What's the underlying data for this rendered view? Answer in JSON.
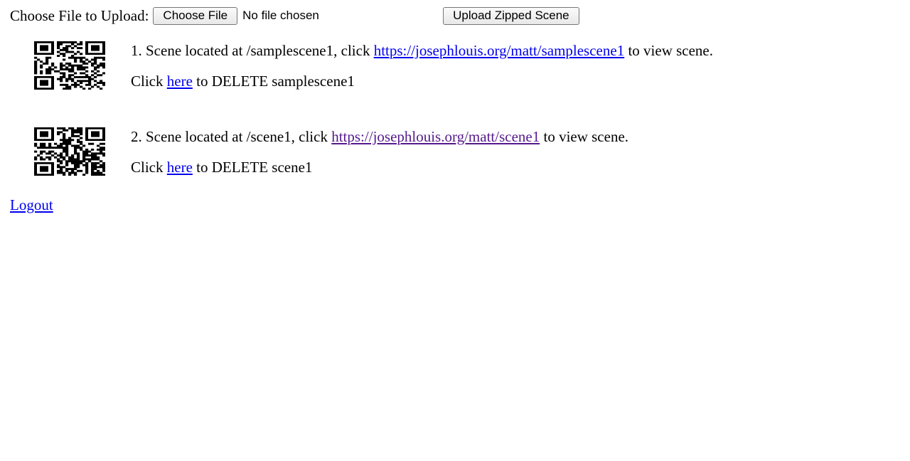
{
  "upload": {
    "label": "Choose File to Upload:",
    "choose_button": "Choose File",
    "file_status": "No file chosen",
    "upload_button": "Upload Zipped Scene"
  },
  "scenes": [
    {
      "index": "1.",
      "text_before": " Scene located at /samplescene1, click ",
      "link": "https://josephlouis.org/matt/samplescene1",
      "text_after": " to view scene.",
      "delete_prefix": "Click ",
      "delete_link": "here",
      "delete_suffix": " to DELETE samplescene1"
    },
    {
      "index": "2.",
      "text_before": " Scene located at /scene1, click ",
      "link": "https://josephlouis.org/matt/scene1",
      "text_after": " to view scene.",
      "delete_prefix": "Click ",
      "delete_link": "here",
      "delete_suffix": " to DELETE scene1"
    }
  ],
  "logout_label": "Logout",
  "colors": {
    "link": "#0000ee",
    "visited_link": "#551a8b"
  }
}
